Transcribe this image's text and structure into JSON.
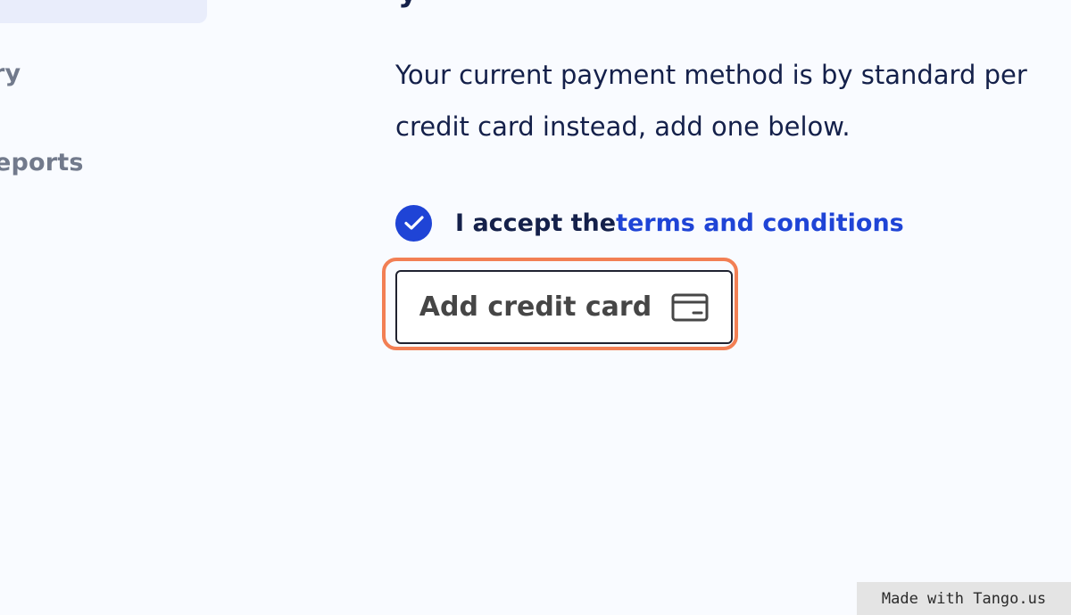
{
  "sidebar": {
    "items": [
      {
        "label": "ry"
      },
      {
        "label": "eports"
      }
    ]
  },
  "main": {
    "heading_fragment": "y",
    "payment_text": {
      "line1": "Your current payment method is by standard per",
      "line2": "credit card instead, add one below."
    },
    "terms": {
      "checked": true,
      "label": "I accept the ",
      "link_label": "terms and conditions"
    },
    "add_card_button": {
      "label": "Add credit card",
      "icon": "credit-card-icon"
    }
  },
  "watermark": {
    "text": "Made with Tango.us"
  },
  "colors": {
    "accent": "#1f44d6",
    "highlight": "#f27f54",
    "text": "#14204a",
    "sidebar_text": "#727a8c",
    "background": "#f9fbff"
  }
}
